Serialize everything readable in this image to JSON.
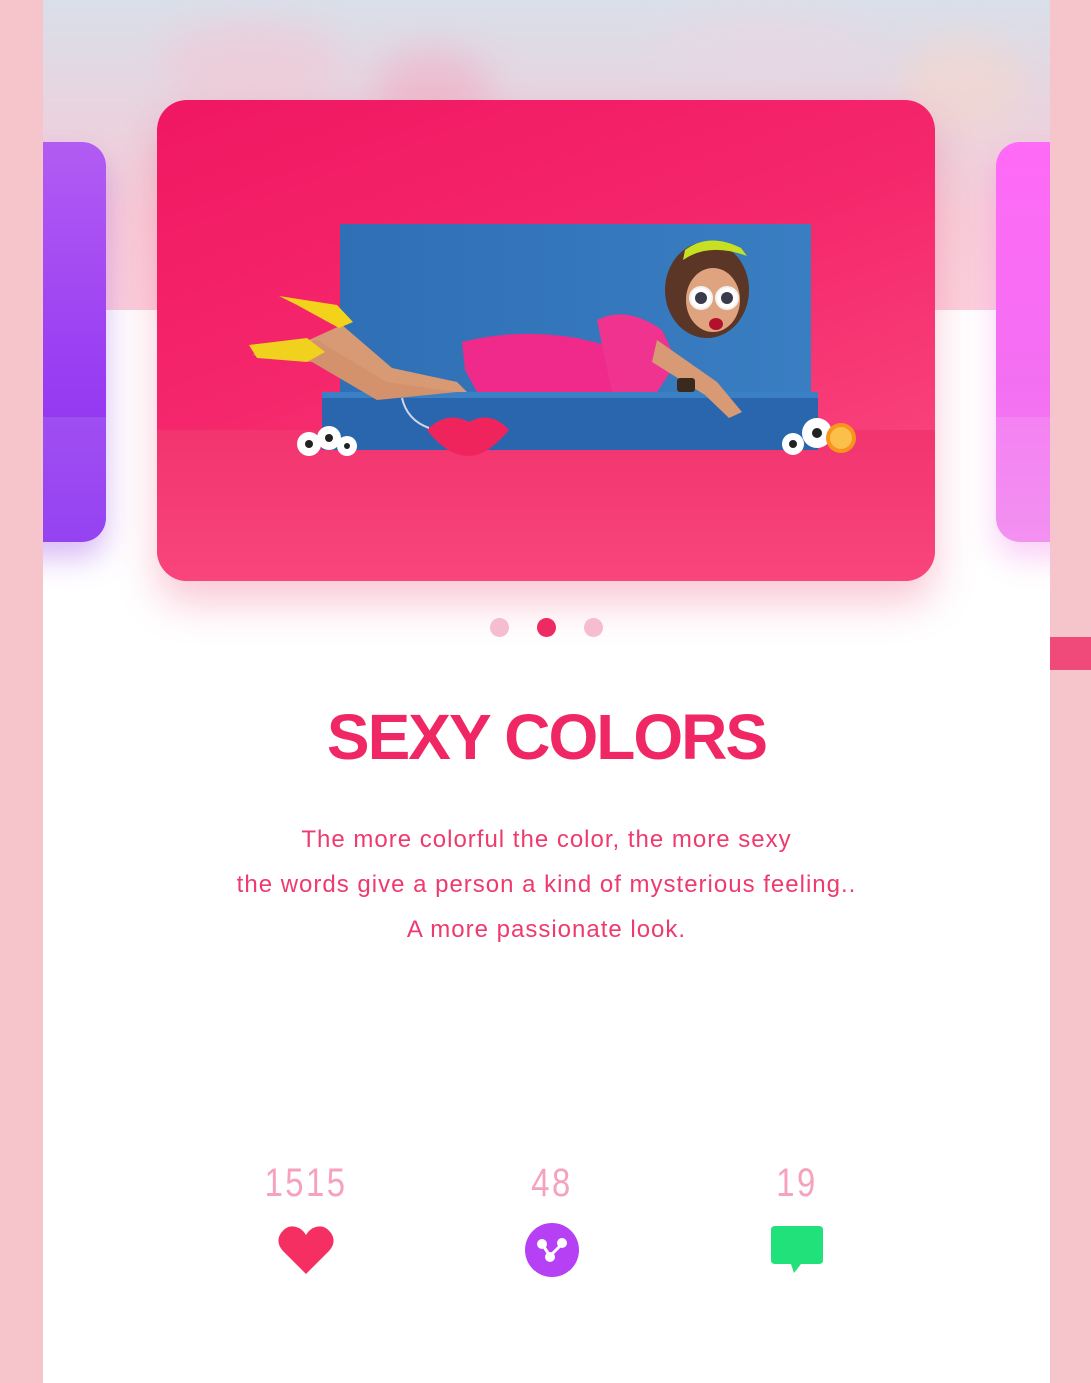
{
  "carousel": {
    "pages": 3,
    "active_index": 1
  },
  "card": {
    "title": "SEXY COLORS",
    "description": [
      "The more colorful the color, the more sexy",
      "the words give a person a kind of mysterious feeling..",
      "A more passionate look."
    ]
  },
  "stats": {
    "likes": "1515",
    "shares": "48",
    "comments": "19"
  },
  "icons": {
    "likes": "heart-icon",
    "shares": "share-icon",
    "comments": "comment-icon"
  },
  "colors": {
    "accent": "#ef2865",
    "likes": "#f52f62",
    "shares": "#b640f4",
    "comments": "#21e27a",
    "side_left": "#9a3ff2",
    "side_right": "#f36ff2"
  }
}
